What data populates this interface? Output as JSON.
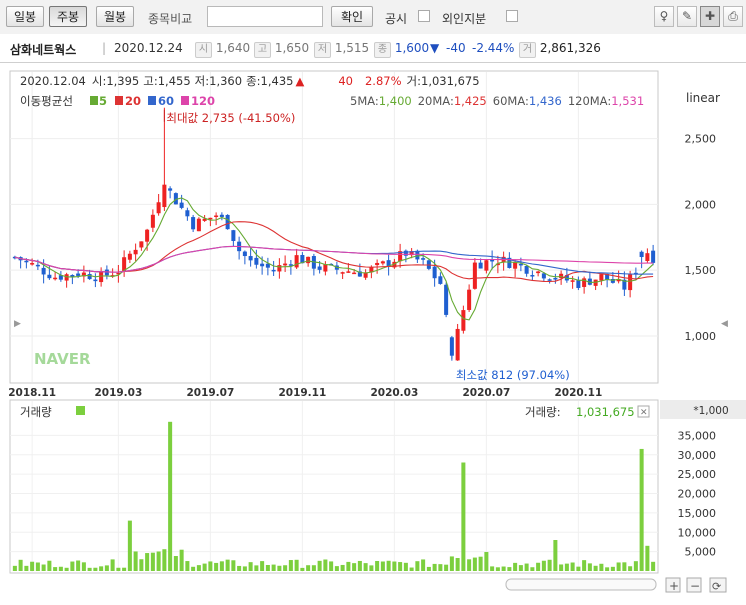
{
  "toolbar": {
    "daily": "일봉",
    "weekly": "주봉",
    "monthly": "월봉",
    "compare_label": "종목비교",
    "compare_input": "",
    "confirm": "확인",
    "disclosure": "공시",
    "foreign": "외인지분"
  },
  "quote": {
    "name": "삼화네트웍스",
    "date": "2020.12.24",
    "open_tag": "시",
    "open": "1,640",
    "high_tag": "고",
    "high": "1,650",
    "low_tag": "저",
    "low": "1,515",
    "close_tag": "종",
    "close": "1,600",
    "change_arrow": "▼",
    "change": "-40",
    "change_pct": "-2.44%",
    "volume_tag": "거",
    "volume": "2,861,326"
  },
  "info": {
    "date": "2020.12.04",
    "open_label": "시:",
    "open": "1,395",
    "high_label": "고:",
    "high": "1,455",
    "low_label": "저:",
    "low": "1,360",
    "close_label": "종:",
    "close": "1,435",
    "arrow": "▲",
    "change": "40",
    "pct": "2.87%",
    "vol_label": "거:",
    "vol": "1,031,675"
  },
  "ma_legend": {
    "title": "이동평균선",
    "items": [
      {
        "label": "5",
        "color": "#66aa33"
      },
      {
        "label": "20",
        "color": "#dd3333"
      },
      {
        "label": "60",
        "color": "#3366cc"
      },
      {
        "label": "120",
        "color": "#dd44aa"
      }
    ],
    "values": [
      {
        "label": "5MA:",
        "value": "1,400",
        "color": "#66aa33"
      },
      {
        "label": "20MA:",
        "value": "1,425",
        "color": "#dd3333"
      },
      {
        "label": "60MA:",
        "value": "1,436",
        "color": "#3366cc"
      },
      {
        "label": "120MA:",
        "value": "1,531",
        "color": "#dd44aa"
      }
    ]
  },
  "scale_label": "linear",
  "watermark": "NAVER",
  "annotations": {
    "max": "최대값 2,735 (-41.50%)",
    "min": "최소값 812 (97.04%)"
  },
  "volume_panel": {
    "title": "거래량",
    "value_label": "거래량:",
    "value": "1,031,675",
    "unit": "*1,000"
  },
  "colors": {
    "up": "#ee2222",
    "down": "#1f5fd0",
    "volume": "#7ccf3e"
  },
  "chart_data": [
    {
      "type": "candlestick",
      "title": "",
      "x_ticks": [
        "2018.11",
        "2019.03",
        "2019.07",
        "2019.11",
        "2020.03",
        "2020.07",
        "2020.11"
      ],
      "y_ticks": [
        1000,
        1500,
        2000,
        2500
      ],
      "ylim": [
        650,
        2900
      ],
      "weeks": 112,
      "candles_sample": [
        {
          "week": 26,
          "high": 2735,
          "low": 1950,
          "close": 2150
        },
        {
          "week": 76,
          "high": 1000,
          "low": 812,
          "close": 850
        },
        {
          "week": 109,
          "high": 1650,
          "low": 1515,
          "close": 1600
        }
      ],
      "series": [
        {
          "name": "5"
        },
        {
          "name": "20"
        },
        {
          "name": "60"
        },
        {
          "name": "120"
        }
      ]
    },
    {
      "type": "bar",
      "title": "거래량",
      "y_ticks": [
        5000,
        10000,
        15000,
        20000,
        25000,
        30000,
        35000
      ],
      "ylim": [
        0,
        40000
      ],
      "peaks": [
        {
          "week": 20,
          "value": 13000
        },
        {
          "week": 27,
          "value": 38500
        },
        {
          "week": 78,
          "value": 28000
        },
        {
          "week": 94,
          "value": 8000
        },
        {
          "week": 109,
          "value": 31500
        },
        {
          "week": 110,
          "value": 6500
        }
      ]
    }
  ]
}
